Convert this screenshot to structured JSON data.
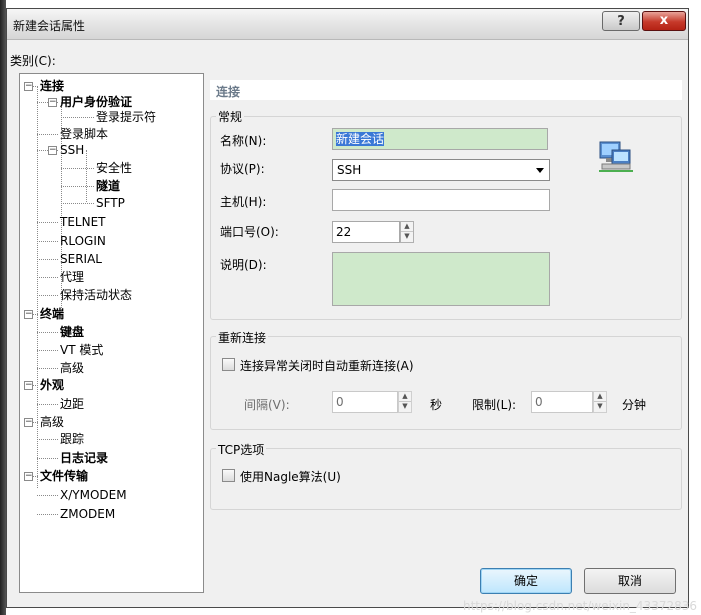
{
  "window": {
    "title": "新建会话属性",
    "help_label": "?",
    "close_label": "x"
  },
  "tree": {
    "label": "类别(C):",
    "items": [
      {
        "label": "连接",
        "bold": true
      },
      {
        "label": "用户身份验证",
        "bold": true
      },
      {
        "label": "登录提示符",
        "bold": false
      },
      {
        "label": "登录脚本",
        "bold": false
      },
      {
        "label": "SSH",
        "bold": false
      },
      {
        "label": "安全性",
        "bold": false
      },
      {
        "label": "隧道",
        "bold": true
      },
      {
        "label": "SFTP",
        "bold": false
      },
      {
        "label": "TELNET",
        "bold": false
      },
      {
        "label": "RLOGIN",
        "bold": false
      },
      {
        "label": "SERIAL",
        "bold": false
      },
      {
        "label": "代理",
        "bold": false
      },
      {
        "label": "保持活动状态",
        "bold": false
      },
      {
        "label": "终端",
        "bold": true
      },
      {
        "label": "键盘",
        "bold": true
      },
      {
        "label": "VT 模式",
        "bold": false
      },
      {
        "label": "高级",
        "bold": false
      },
      {
        "label": "外观",
        "bold": true
      },
      {
        "label": "边距",
        "bold": false
      },
      {
        "label": "高级",
        "bold": false
      },
      {
        "label": "跟踪",
        "bold": false
      },
      {
        "label": "日志记录",
        "bold": true
      },
      {
        "label": "文件传输",
        "bold": true
      },
      {
        "label": "X/YMODEM",
        "bold": false
      },
      {
        "label": "ZMODEM",
        "bold": false
      }
    ]
  },
  "panel": {
    "header": "连接",
    "general": {
      "title": "常规",
      "name_label": "名称(N):",
      "name_value": "新建会话",
      "protocol_label": "协议(P):",
      "protocol_value": "SSH",
      "host_label": "主机(H):",
      "host_value": "",
      "port_label": "端口号(O):",
      "port_value": "22",
      "desc_label": "说明(D):",
      "desc_value": ""
    },
    "reconnect": {
      "title": "重新连接",
      "auto_label": "连接异常关闭时自动重新连接(A)",
      "interval_label": "间隔(V):",
      "interval_value": "0",
      "interval_unit": "秒",
      "limit_label": "限制(L):",
      "limit_value": "0",
      "limit_unit": "分钟"
    },
    "tcp": {
      "title": "TCP选项",
      "nagle_label": "使用Nagle算法(U)"
    }
  },
  "buttons": {
    "ok": "确定",
    "cancel": "取消"
  },
  "watermark": "https://blog.csdn.net/weixin_43372836"
}
